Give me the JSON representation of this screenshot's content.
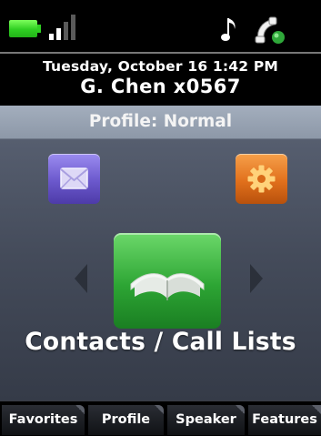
{
  "status": {
    "icons": [
      "battery-icon",
      "signal-strength-icon",
      "ringtone-note-icon",
      "handset-icon"
    ],
    "battery_color": "#2fcf22",
    "signal_bars_active": 2,
    "signal_bars_total": 4
  },
  "header": {
    "date": "Tuesday, October 16 1:42 PM",
    "user": "G. Chen x0567"
  },
  "profile_bar": {
    "label": "Profile: Normal"
  },
  "main": {
    "icons": [
      {
        "name": "messages-icon",
        "color": "#6b58cc"
      },
      {
        "name": "settings-gear-icon",
        "color": "#e1701c"
      },
      {
        "name": "contacts-book-icon",
        "color": "#2da534"
      }
    ],
    "focused_label": "Contacts / Call Lists"
  },
  "softkeys": [
    {
      "label": "Favorites"
    },
    {
      "label": "Profile"
    },
    {
      "label": "Speaker"
    },
    {
      "label": "Features"
    }
  ]
}
